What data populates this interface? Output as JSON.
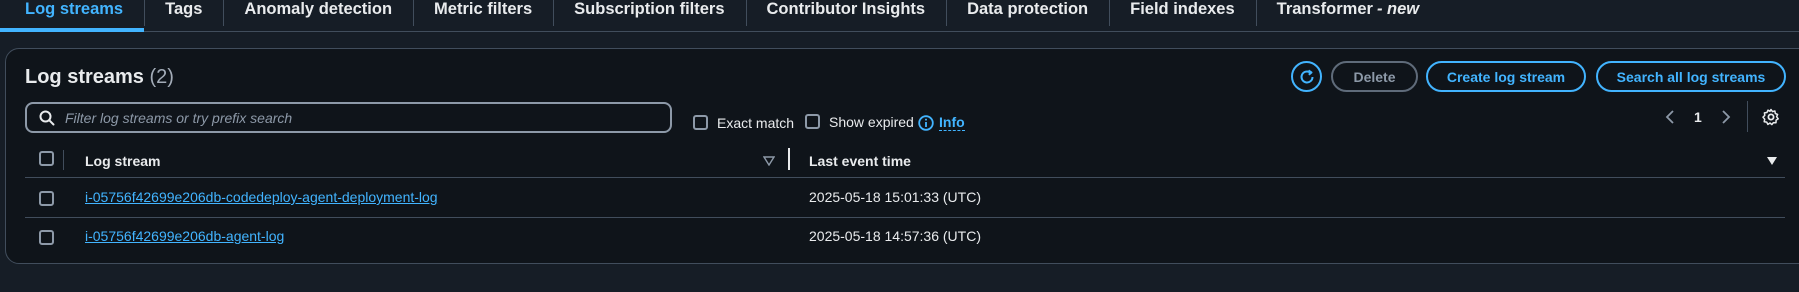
{
  "tabs": [
    {
      "label": "Log streams"
    },
    {
      "label": "Tags"
    },
    {
      "label": "Anomaly detection"
    },
    {
      "label": "Metric filters"
    },
    {
      "label": "Subscription filters"
    },
    {
      "label": "Contributor Insights"
    },
    {
      "label": "Data protection"
    },
    {
      "label": "Field indexes"
    },
    {
      "label": "Transformer",
      "badge": "- new"
    }
  ],
  "panel": {
    "title": "Log streams",
    "count": "(2)",
    "buttons": {
      "delete": "Delete",
      "create": "Create log stream",
      "search_all": "Search all log streams"
    },
    "search": {
      "placeholder": "Filter log streams or try prefix search",
      "value": ""
    },
    "exact_match": {
      "label": "Exact match",
      "checked": false
    },
    "show_expired": {
      "label": "Show expired",
      "checked": false
    },
    "info_link": "Info",
    "pagination": {
      "current_page": "1"
    },
    "table": {
      "columns": [
        "Log stream",
        "Last event time"
      ],
      "rows": [
        {
          "stream": "i-05756f42699e206db-codedeploy-agent-deployment-log",
          "last_event": "2025-05-18 15:01:33 (UTC)"
        },
        {
          "stream": "i-05756f42699e206db-agent-log",
          "last_event": "2025-05-18 14:57:36 (UTC)"
        }
      ]
    }
  },
  "colors": {
    "accent": "#42b4ff",
    "background": "#0f141a",
    "border": "#414d5c"
  }
}
